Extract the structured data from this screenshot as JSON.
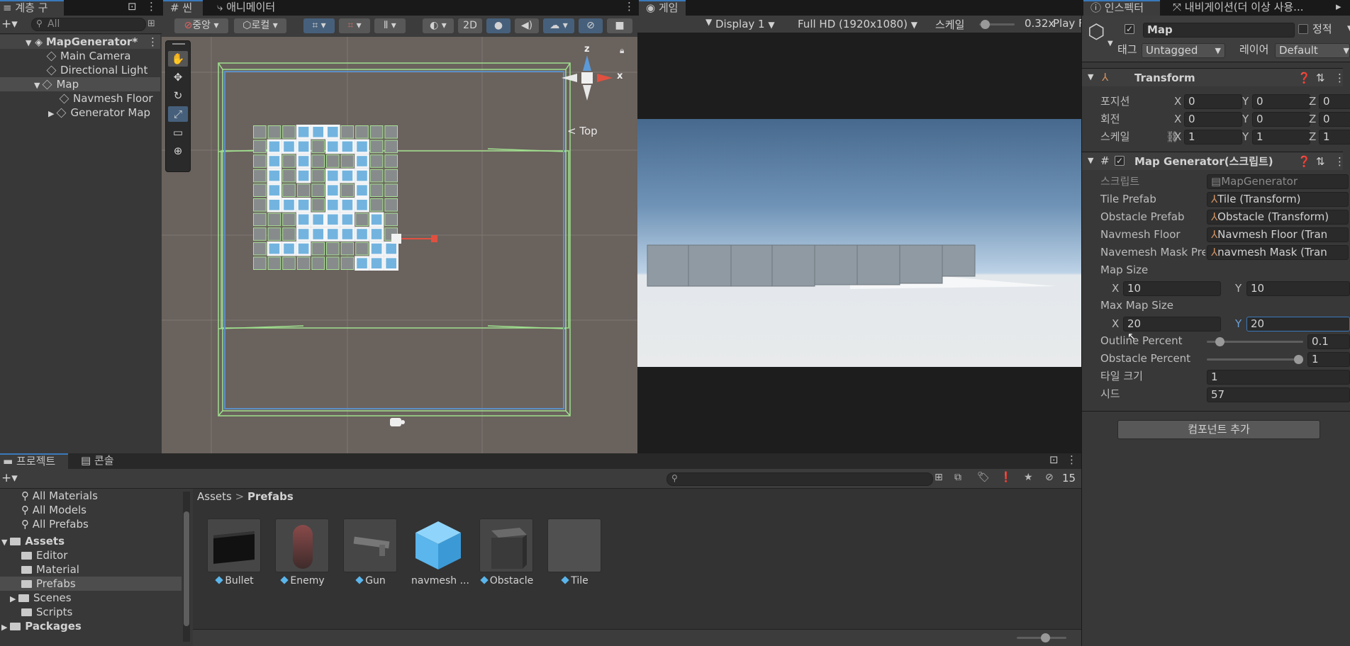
{
  "hierarchy": {
    "tab_label": "계층 구조",
    "search_placeholder": "All",
    "root": "MapGenerator*",
    "items": [
      "Main Camera",
      "Directional Light",
      "Map",
      "Navmesh Floor",
      "Generator Map"
    ]
  },
  "scene": {
    "tab_scene": "씬",
    "tab_animator": "애니메이터",
    "pivot_label": "중앙",
    "space_label": "로컬",
    "btn_2d": "2D",
    "axis_x": "x",
    "axis_z": "z",
    "view_label": "< Top"
  },
  "game": {
    "tab_label": "게임",
    "display": "Display 1",
    "resolution": "Full HD (1920x1080)",
    "scale_label": "스케일",
    "scale_value": "0.32x",
    "play_label": "Play F",
    "scale_level": 0.05
  },
  "inspector": {
    "tab_label": "인스펙터",
    "tab_nav": "내비게이션(더 이상 사용...",
    "object_name": "Map",
    "static_label": "정적",
    "tag_label": "태그",
    "tag_value": "Untagged",
    "layer_label": "레이어",
    "layer_value": "Default",
    "transform": {
      "title": "Transform",
      "position_label": "포지션",
      "rotation_label": "회전",
      "scale_label": "스케일",
      "position": [
        "0",
        "0",
        "0"
      ],
      "rotation": [
        "0",
        "0",
        "0"
      ],
      "scale": [
        "1",
        "1",
        "1"
      ],
      "axis": [
        "X",
        "Y",
        "Z"
      ]
    },
    "script": {
      "title": "Map Generator(스크립트)",
      "script_label": "스크립트",
      "script_value": "MapGenerator",
      "tile_prefab_label": "Tile Prefab",
      "tile_prefab_value": "Tile (Transform)",
      "obstacle_prefab_label": "Obstacle Prefab",
      "obstacle_prefab_value": "Obstacle (Transform)",
      "navmesh_floor_label": "Navmesh Floor",
      "navmesh_floor_value": "Navmesh Floor (Tran",
      "navmesh_mask_label": "Navemesh Mask Pre",
      "navmesh_mask_value": "navmesh Mask (Tran",
      "map_size_label": "Map Size",
      "map_size_x": "10",
      "map_size_y": "10",
      "max_map_size_label": "Max Map Size",
      "max_map_size_x": "20",
      "max_map_size_y": "20",
      "outline_label": "Outline Percent",
      "outline_value": "0.1",
      "outline_level": 0.1,
      "obstacle_label": "Obstacle Percent",
      "obstacle_value": "1",
      "obstacle_level": 1,
      "tile_size_label": "타일 크기",
      "tile_size_value": "1",
      "seed_label": "시드",
      "seed_value": "57"
    },
    "add_component": "컴포넌트 추가"
  },
  "project": {
    "tab_project": "프로젝트",
    "tab_console": "콘솔",
    "hidden_count": "15",
    "breadcrumb_root": "Assets",
    "breadcrumb_sep": ">",
    "breadcrumb_current": "Prefabs",
    "favorites": [
      "All Materials",
      "All Models",
      "All Prefabs"
    ],
    "assets_root": "Assets",
    "folders": [
      "Editor",
      "Material",
      "Prefabs",
      "Scenes",
      "Scripts"
    ],
    "packages": "Packages",
    "assets": [
      "Bullet",
      "Enemy",
      "Gun",
      "navmesh ...",
      "Obstacle",
      "Tile"
    ]
  },
  "colors": {
    "accent": "#3a79bb",
    "selection": "#2c5d87",
    "prefab_blue": "#5ab6ec",
    "scene_bg": "#6a625d",
    "sky_top": "#4b6b8e",
    "sky_horizon": "#c9d9e8"
  }
}
